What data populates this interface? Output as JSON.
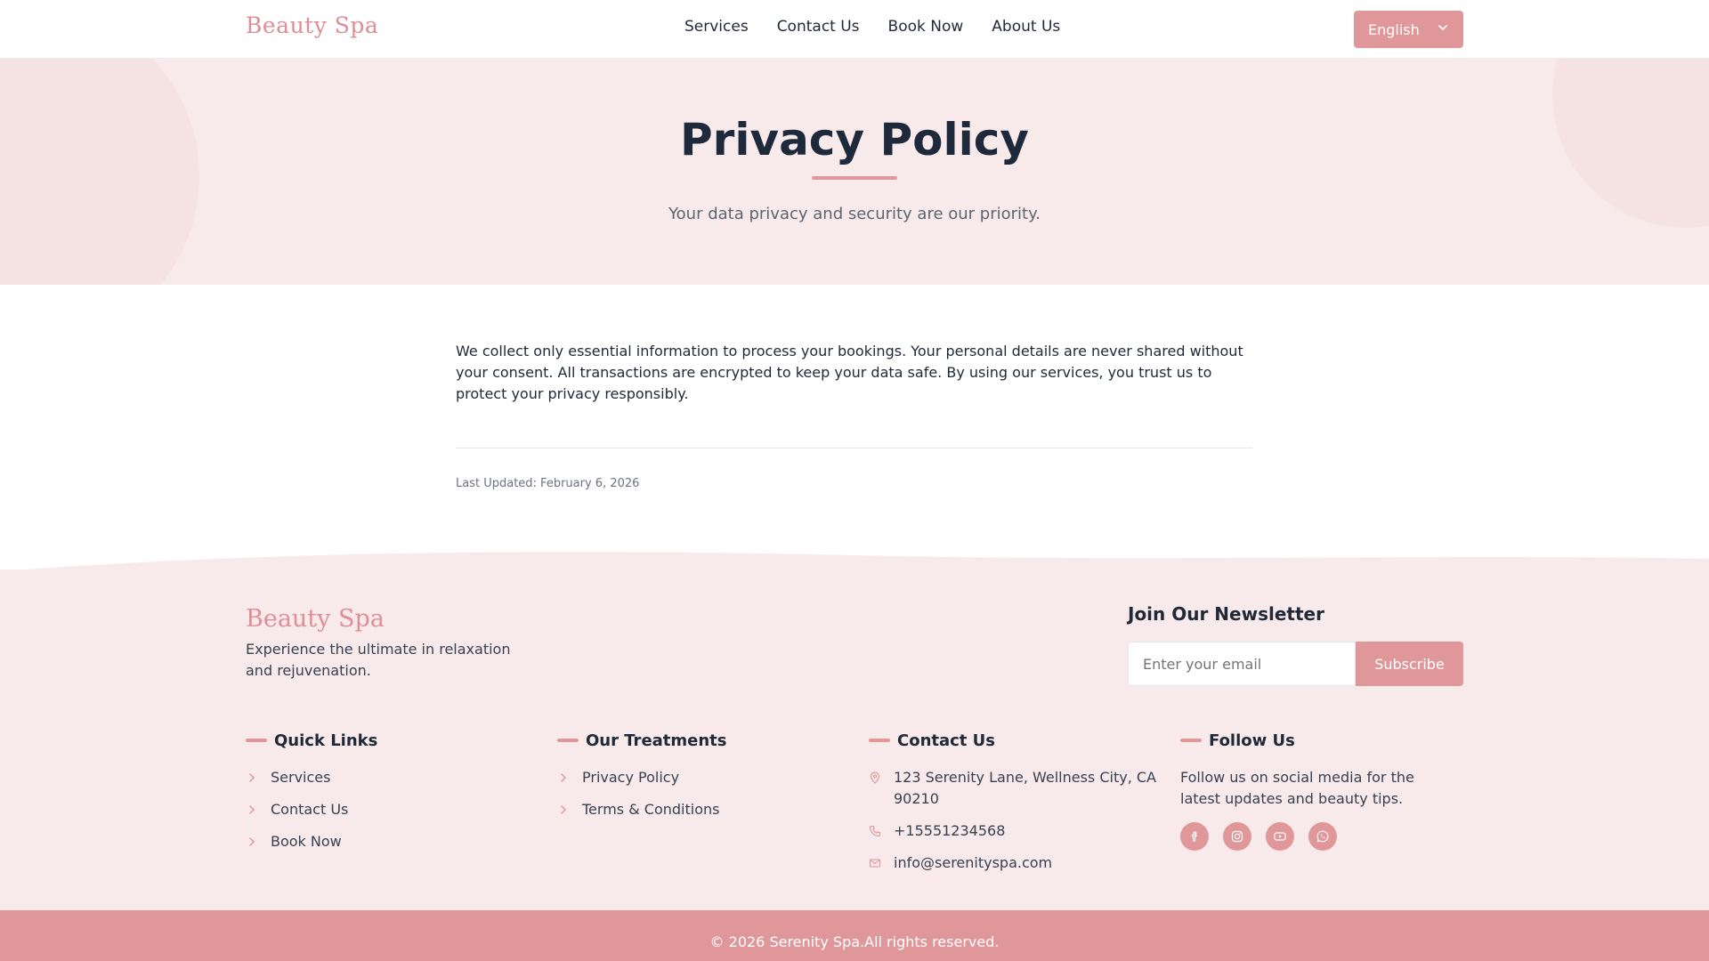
{
  "header": {
    "logo": "Beauty Spa",
    "nav": [
      "Services",
      "Contact Us",
      "Book Now",
      "About Us"
    ],
    "language": "English"
  },
  "hero": {
    "title": "Privacy Policy",
    "subtitle": "Your data privacy and security are our priority."
  },
  "content": {
    "paragraph": "We collect only essential information to process your bookings. Your personal details are never shared without your consent. All transactions are encrypted to keep your data safe. By using our services, you trust us to protect your privacy responsibly.",
    "last_updated": "Last Updated: February 6, 2026"
  },
  "footer": {
    "logo": "Beauty Spa",
    "tagline": "Experience the ultimate in relaxation and rejuvenation.",
    "newsletter": {
      "title": "Join Our Newsletter",
      "placeholder": "Enter your email",
      "button": "Subscribe"
    },
    "quick_links": {
      "title": "Quick Links",
      "items": [
        "Services",
        "Contact Us",
        "Book Now"
      ]
    },
    "treatments": {
      "title": "Our Treatments",
      "items": [
        "Privacy Policy",
        "Terms & Conditions"
      ]
    },
    "contact": {
      "title": "Contact Us",
      "address": "123 Serenity Lane, Wellness City, CA 90210",
      "phone": "+15551234568",
      "email": "info@serenityspa.com"
    },
    "follow": {
      "title": "Follow Us",
      "text": "Follow us on social media for the latest updates and beauty tips.",
      "icons": [
        "facebook-icon",
        "instagram-icon",
        "youtube-icon",
        "whatsapp-icon"
      ]
    },
    "copyright": "© 2026 Serenity Spa.All rights reserved."
  },
  "colors": {
    "accent": "#e0979a",
    "hero_bg": "#f8eaea",
    "heading": "#1e293b"
  }
}
